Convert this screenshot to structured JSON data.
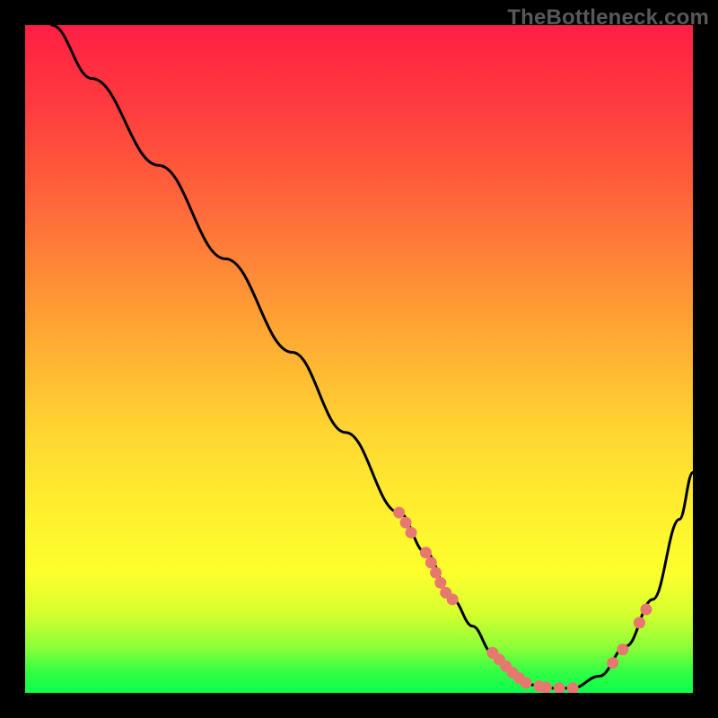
{
  "watermark": "TheBottleneck.com",
  "colors": {
    "background": "#000000",
    "curve": "#000000",
    "dots": "#e6786f",
    "gradient": [
      "#ff1f44",
      "#ff3b3f",
      "#ff6b3a",
      "#ffae33",
      "#ffd931",
      "#fff22e",
      "#fdff2c",
      "#d7ff2e",
      "#8eff37",
      "#2fff45",
      "#0dff4d"
    ]
  },
  "chart_data": {
    "type": "line",
    "title": "",
    "xlabel": "",
    "ylabel": "",
    "xlim": [
      0,
      100
    ],
    "ylim": [
      0,
      100
    ],
    "grid": false,
    "series": [
      {
        "name": "bottleneck-curve",
        "x": [
          4,
          10,
          20,
          30,
          40,
          48,
          56,
          60,
          64,
          67,
          70,
          73,
          76,
          78,
          82,
          86,
          90,
          94,
          98,
          100
        ],
        "values": [
          100,
          92,
          79,
          65,
          51,
          39,
          27,
          21,
          14,
          10,
          6,
          3,
          1.2,
          0.7,
          0.7,
          2.5,
          7,
          14,
          26,
          33
        ]
      }
    ],
    "marker_clusters": [
      {
        "name": "left-descent-upper",
        "points": [
          [
            56,
            27
          ],
          [
            57,
            25.5
          ],
          [
            57.8,
            24
          ]
        ]
      },
      {
        "name": "left-descent-mid",
        "points": [
          [
            60,
            21
          ],
          [
            60.8,
            19.5
          ],
          [
            61.5,
            18
          ],
          [
            62.2,
            16.5
          ],
          [
            63,
            15
          ],
          [
            64,
            14
          ]
        ]
      },
      {
        "name": "valley",
        "points": [
          [
            70,
            6
          ],
          [
            71,
            5
          ],
          [
            72,
            4
          ],
          [
            73,
            3
          ],
          [
            74,
            2.2
          ],
          [
            75,
            1.5
          ],
          [
            77,
            1
          ],
          [
            78,
            0.8
          ],
          [
            80,
            0.7
          ],
          [
            82,
            0.7
          ]
        ]
      },
      {
        "name": "right-ascent",
        "points": [
          [
            88,
            4.5
          ],
          [
            89.5,
            6.5
          ],
          [
            92,
            10.5
          ],
          [
            93,
            12.5
          ]
        ]
      }
    ]
  }
}
